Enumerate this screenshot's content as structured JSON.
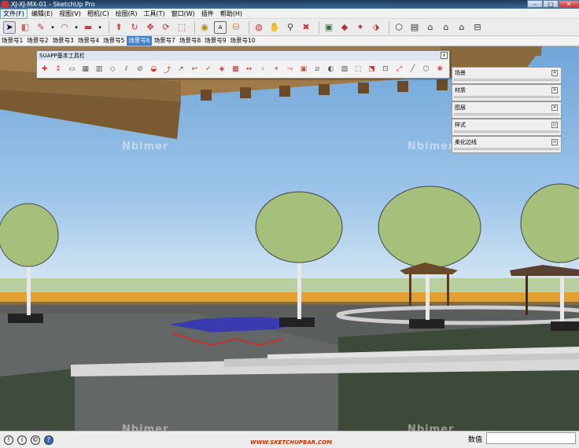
{
  "window": {
    "title": "XJ-XJ-MX-01 - SketchUp Pro",
    "min_label": "–",
    "max_label": "□",
    "close_label": "✕"
  },
  "menu": [
    {
      "label": "文件(F)"
    },
    {
      "label": "编辑(E)"
    },
    {
      "label": "视图(V)"
    },
    {
      "label": "相机(C)"
    },
    {
      "label": "绘图(R)"
    },
    {
      "label": "工具(T)"
    },
    {
      "label": "窗口(W)"
    },
    {
      "label": "插件"
    },
    {
      "label": "帮助(H)"
    }
  ],
  "toolbar_icons": [
    "select-icon",
    "eraser-icon",
    "pencil-icon",
    "dropdown-icon",
    "arc-icon",
    "dropdown-icon",
    "rectangle-icon",
    "dropdown-icon",
    "push-pull-icon",
    "offset-icon",
    "move-icon",
    "rotate-icon",
    "scale-icon",
    "tape-measure-icon",
    "text-icon",
    "paint-bucket-icon",
    "orbit-icon",
    "pan-icon",
    "zoom-icon",
    "zoom-extents-icon",
    "component-icon",
    "3d-warehouse-icon",
    "extension-icon",
    "share-icon",
    "iso-view-icon",
    "front-view-icon",
    "top-view-icon",
    "right-view-icon",
    "back-view-icon",
    "left-view-icon"
  ],
  "scenes": [
    "场景号1",
    "场景号2",
    "场景号3",
    "场景号4",
    "场景号5",
    "场景号6",
    "场景号7",
    "场景号8",
    "场景号9",
    "场景号10"
  ],
  "active_scene_index": 5,
  "suapp": {
    "title": "SUAPP基本工具栏",
    "close_label": "x"
  },
  "tray": [
    {
      "label": "场景"
    },
    {
      "label": "材质"
    },
    {
      "label": "图层"
    },
    {
      "label": "样式"
    },
    {
      "label": "柔化边线"
    }
  ],
  "status": {
    "measure_label": "数值",
    "watermark_link": "WWW.SKETCHUPBAR.COM",
    "nbimer": "Nbimer"
  },
  "colors": {
    "accent_tab": "#3c7fd0",
    "sky_top": "#6fa6d8",
    "wood": "#8a6a3c"
  }
}
